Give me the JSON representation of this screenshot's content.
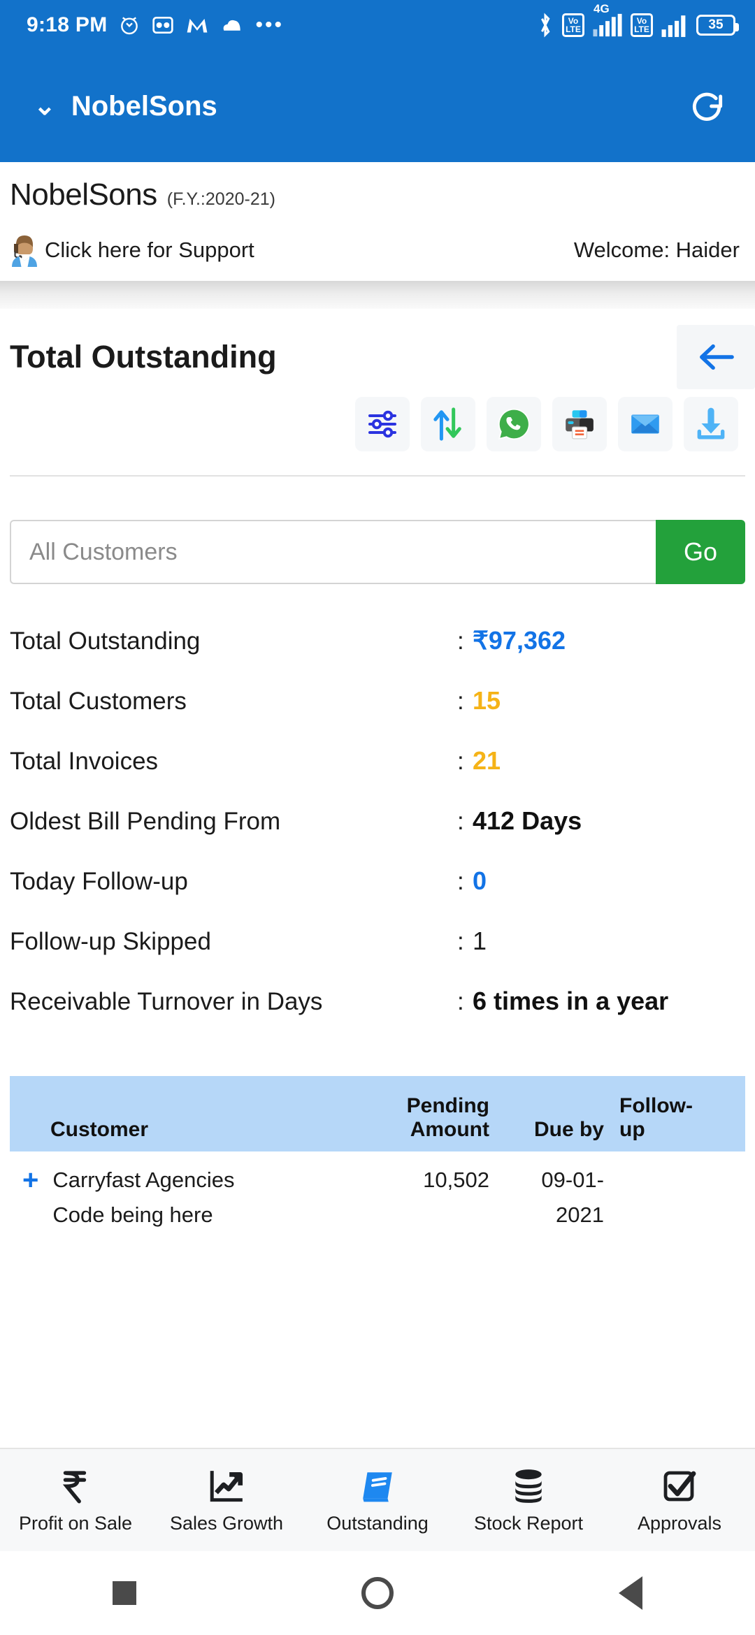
{
  "status_bar": {
    "time": "9:18 PM",
    "battery": "35",
    "network_label": "4G",
    "volte_top": "Vo",
    "volte_bottom": "LTE",
    "overflow": "•••",
    "icons": [
      "alarm-icon",
      "voicemail-icon",
      "m-app-icon",
      "cloud-icon",
      "overflow-dots-icon",
      "bluetooth-icon",
      "volte-icon",
      "signal-icon",
      "battery-icon"
    ]
  },
  "app_bar": {
    "title": "NobelSons",
    "chevron": "⌄",
    "refresh_icon": "refresh-icon"
  },
  "company": {
    "name": "NobelSons",
    "financial_year": "(F.Y.:2020-21)",
    "support_text": "Click here for Support",
    "welcome_text": "Welcome: Haider"
  },
  "page": {
    "title": "Total Outstanding",
    "back_icon": "arrow-left-icon"
  },
  "toolbar": {
    "items": [
      {
        "name": "filter-icon",
        "label": "Filter"
      },
      {
        "name": "sort-icon",
        "label": "Sort"
      },
      {
        "name": "whatsapp-icon",
        "label": "WhatsApp"
      },
      {
        "name": "printer-icon",
        "label": "Print"
      },
      {
        "name": "email-icon",
        "label": "Email"
      },
      {
        "name": "download-icon",
        "label": "Download"
      }
    ]
  },
  "search": {
    "placeholder": "All Customers",
    "value": "",
    "button_label": "Go"
  },
  "stats": [
    {
      "label": "Total Outstanding",
      "value": "₹97,362",
      "style": "blue"
    },
    {
      "label": "Total Customers",
      "value": "15",
      "style": "amber"
    },
    {
      "label": "Total Invoices",
      "value": "21",
      "style": "amber"
    },
    {
      "label": "Oldest Bill Pending From",
      "value": "412 Days",
      "style": "bold"
    },
    {
      "label": "Today Follow-up",
      "value": "0",
      "style": "blue"
    },
    {
      "label": "Follow-up Skipped",
      "value": "1",
      "style": "plain"
    },
    {
      "label": "Receivable Turnover in Days",
      "value": "6 times in a year",
      "style": "bold"
    }
  ],
  "table": {
    "columns": [
      "Customer",
      "Pending Amount",
      "Due by",
      "Follow-up"
    ],
    "col_amount_line1": "Pending",
    "col_amount_line2": "Amount",
    "col_followup_line1": "Follow-",
    "col_followup_line2": "up",
    "rows": [
      {
        "expand": "+",
        "customer_line1": "Carryfast Agencies",
        "customer_line2": "Code being here",
        "pending_amount": "10,502",
        "due_by_line1": "09-01-",
        "due_by_line2": "2021",
        "follow_up": ""
      }
    ]
  },
  "bottom_nav": [
    {
      "label": "Profit on Sale",
      "icon": "rupee-icon",
      "active": false
    },
    {
      "label": "Sales Growth",
      "icon": "chart-growth-icon",
      "active": false
    },
    {
      "label": "Outstanding",
      "icon": "book-icon",
      "active": true
    },
    {
      "label": "Stock Report",
      "icon": "database-icon",
      "active": false
    },
    {
      "label": "Approvals",
      "icon": "checkbox-check-icon",
      "active": false
    }
  ],
  "system_nav": {
    "recent": "square-icon",
    "home": "circle-icon",
    "back": "triangle-back-icon"
  },
  "colors": {
    "brand_blue": "#1272CA",
    "accent_blue": "#1273e6",
    "amber": "#f5b317",
    "green": "#23a13b",
    "table_header": "#b6d7f8"
  }
}
